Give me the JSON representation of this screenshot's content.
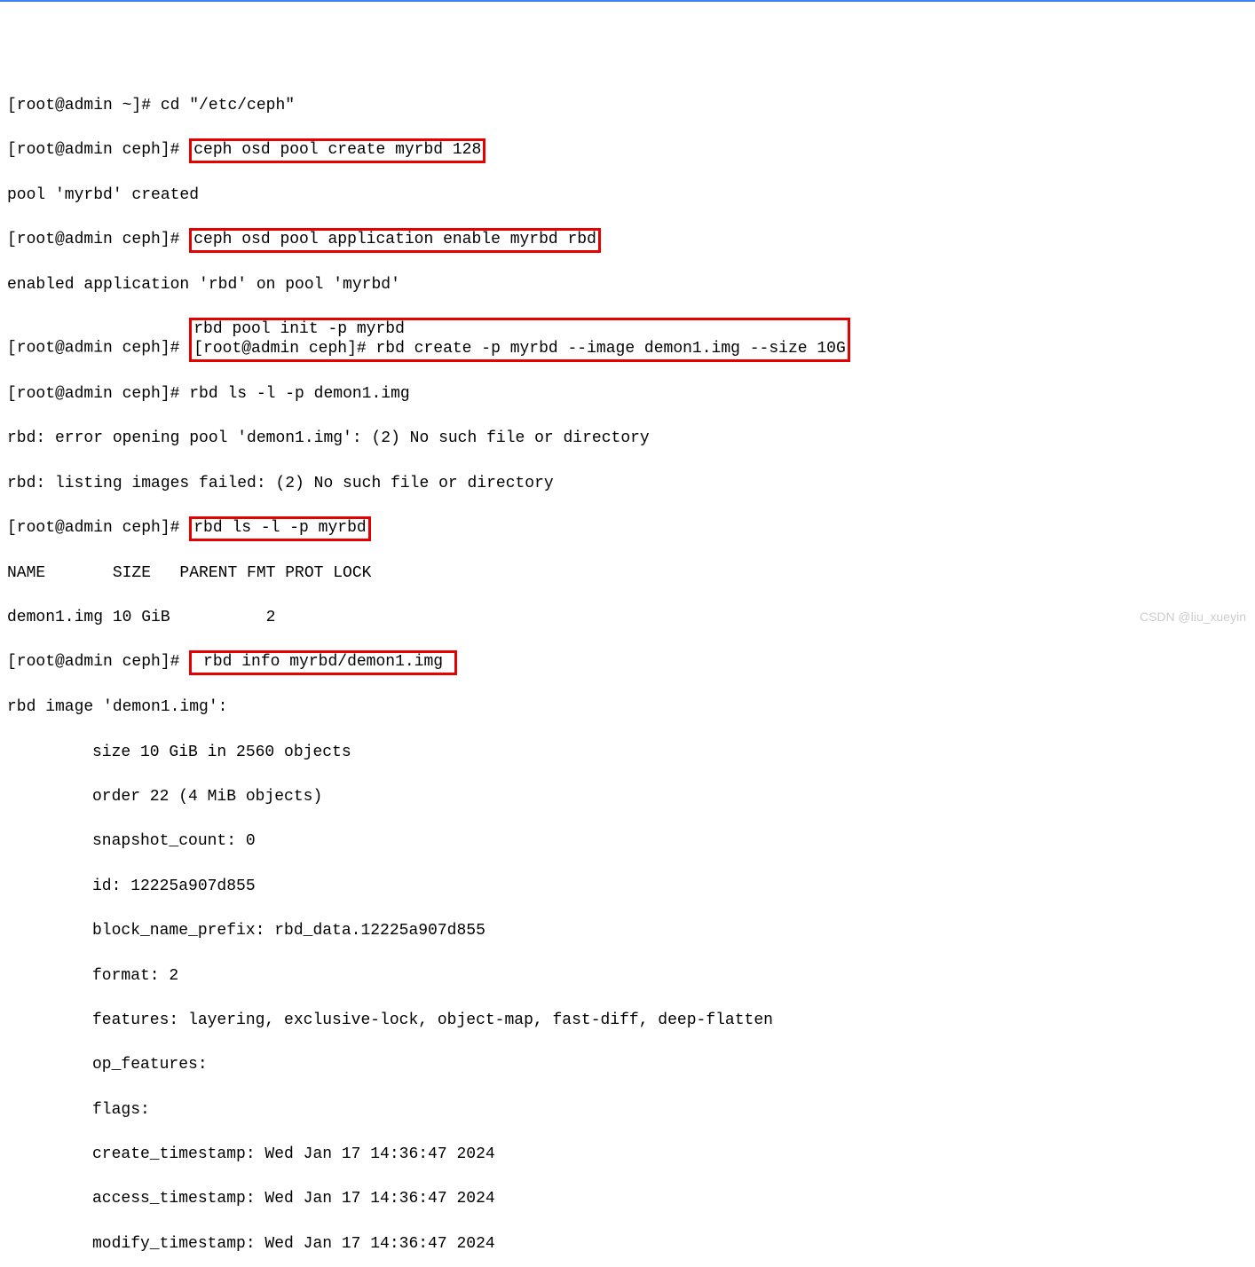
{
  "lines": {
    "l1_prompt": "[root@admin ~]# ",
    "l1_cmd": "cd \"/etc/ceph\"",
    "l2_prompt": "[root@admin ceph]# ",
    "l2_cmd": "ceph osd pool create myrbd 128",
    "l3_out": "pool 'myrbd' created",
    "l4_prompt": "[root@admin ceph]# ",
    "l4_cmd": "ceph osd pool application enable myrbd rbd",
    "l5_out": "enabled application 'rbd' on pool 'myrbd'",
    "l6_prompt": "[root@admin ceph]# ",
    "l6_cmd": "rbd pool init -p myrbd",
    "l7_prompt": "[root@admin ceph]# ",
    "l7_cmd": "rbd create -p myrbd --image demon1.img --size 10G",
    "l8_prompt": "[root@admin ceph]# ",
    "l8_cmd": "rbd ls -l -p demon1.img",
    "l9_out": "rbd: error opening pool 'demon1.img': (2) No such file or directory",
    "l10_out": "rbd: listing images failed: (2) No such file or directory",
    "l11_prompt": "[root@admin ceph]# ",
    "l11_cmd": "rbd ls -l -p myrbd",
    "l12_out": "NAME       SIZE   PARENT FMT PROT LOCK ",
    "l13_out": "demon1.img 10 GiB          2           ",
    "l14_prompt": "[root@admin ceph]# ",
    "l14_cmd": " rbd info myrbd/demon1.img ",
    "l15_out": "rbd image 'demon1.img':",
    "info_size": "size 10 GiB in 2560 objects",
    "info_order": "order 22 (4 MiB objects)",
    "info_snap": "snapshot_count: 0",
    "info_id": "id: 12225a907d855",
    "info_prefix": "block_name_prefix: rbd_data.12225a907d855",
    "info_format": "format: 2",
    "info_features": "features: layering, exclusive-lock, object-map, fast-diff, deep-flatten",
    "info_opfeat": "op_features: ",
    "info_flags": "flags: ",
    "info_create": "create_timestamp: Wed Jan 17 14:36:47 2024",
    "info_access": "access_timestamp: Wed Jan 17 14:36:47 2024",
    "info_modify": "modify_timestamp: Wed Jan 17 14:36:47 2024"
  },
  "watermark": "CSDN @liu_xueyin"
}
